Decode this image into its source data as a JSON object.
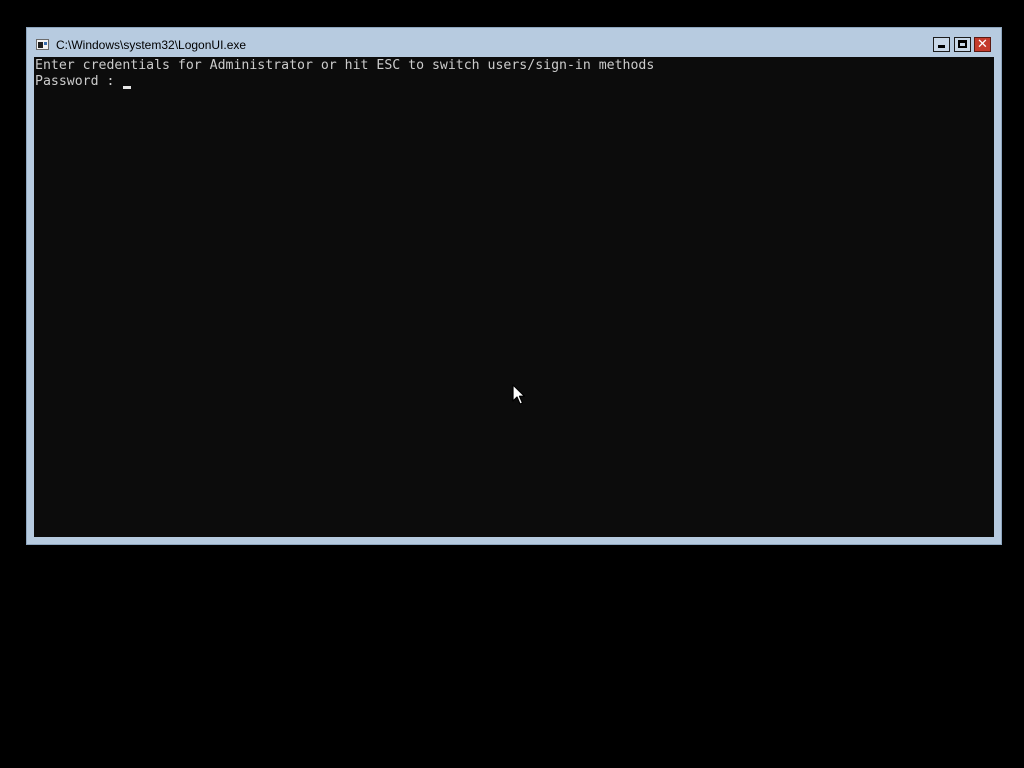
{
  "window": {
    "title": "C:\\Windows\\system32\\LogonUI.exe",
    "icon": "console-app-icon",
    "controls": {
      "minimize": "minimize-icon",
      "maximize": "maximize-icon",
      "close": "close-icon"
    }
  },
  "console": {
    "lines": [
      "Enter credentials for Administrator or hit ESC to switch users/sign-in methods",
      "Password : "
    ],
    "password_input": {
      "value": "",
      "cursor": "block-underscore"
    }
  },
  "pointer": {
    "icon": "mouse-pointer-icon"
  },
  "colors": {
    "desktop_background": "#000000",
    "window_frame": "#b7cbe0",
    "console_background": "#0c0c0c",
    "console_text": "#cccccc",
    "close_button": "#c43b2c"
  }
}
